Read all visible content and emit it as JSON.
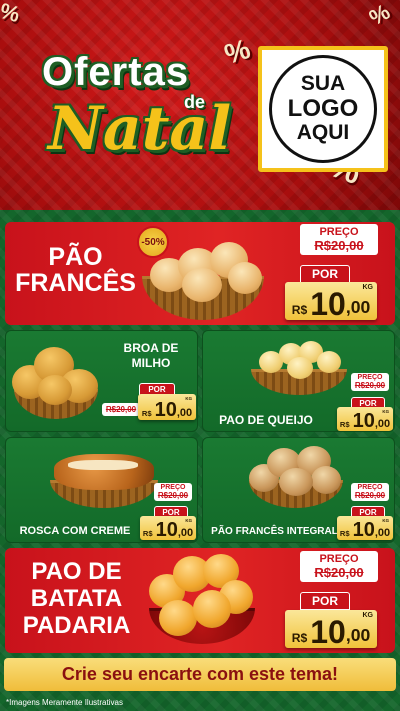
{
  "header": {
    "title_line1": "Ofertas",
    "title_line2": "de",
    "title_line3": "Natal",
    "logo_line1": "SUA",
    "logo_line2": "LOGO",
    "logo_line3": "AQUI",
    "deco_1": "%",
    "deco_2": "%",
    "deco_3": "%",
    "deco_4": "%"
  },
  "products": [
    {
      "name_line1": "PÃO",
      "name_line2": "FRANCÊS",
      "badge": "-50%",
      "preco_label": "PREÇO",
      "old_price": "R$20,00",
      "por_label": "POR",
      "currency": "R$",
      "price_int": "10",
      "price_cents": ",00",
      "unit": "KG"
    },
    {
      "name_line1": "BROA DE",
      "name_line2": "MILHO",
      "preco_label": "",
      "old_price": "R$20,00",
      "por_label": "POR",
      "currency": "R$",
      "price_int": "10",
      "price_cents": ",00",
      "unit": "KG"
    },
    {
      "name_line1": "PAO DE QUEIJO",
      "preco_label": "PREÇO",
      "old_price": "R$20,00",
      "por_label": "POR",
      "currency": "R$",
      "price_int": "10",
      "price_cents": ",00",
      "unit": "KG"
    },
    {
      "name_line1": "ROSCA COM CREME",
      "preco_label": "PREÇO",
      "old_price": "R$20,00",
      "por_label": "POR",
      "currency": "R$",
      "price_int": "10",
      "price_cents": ",00",
      "unit": "KG"
    },
    {
      "name_line1": "PÃO FRANCÊS INTEGRAL",
      "preco_label": "PREÇO",
      "old_price": "R$20,00",
      "por_label": "POR",
      "currency": "R$",
      "price_int": "10",
      "price_cents": ",00",
      "unit": "KG"
    },
    {
      "name_line1": "PAO DE",
      "name_line2": "BATATA",
      "name_line3": "PADARIA",
      "preco_label": "PREÇO",
      "old_price": "R$20,00",
      "por_label": "POR",
      "currency": "R$",
      "price_int": "10",
      "price_cents": ",00",
      "unit": "KG"
    }
  ],
  "cta_text": "Crie seu encarte com este tema!",
  "disclaimer": "*Imagens Meramente Ilustrativas",
  "colors": {
    "red": "#c8121b",
    "green": "#14662b",
    "gold": "#f0c23a"
  }
}
